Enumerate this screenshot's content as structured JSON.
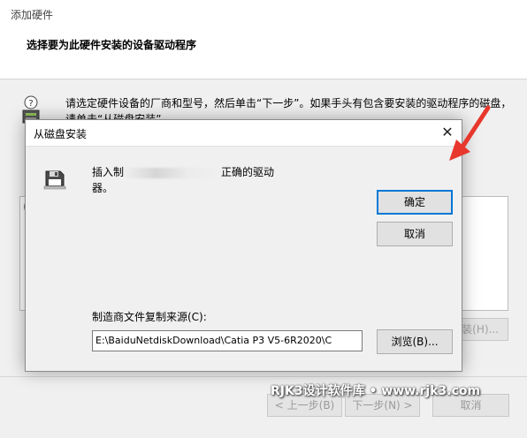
{
  "wizard": {
    "title": "添加硬件",
    "heading": "选择要为此硬件安装的设备驱动程序",
    "instruction_line1": "请选定硬件设备的厂商和型号，然后单击“下一步”。如果手头有包含要安装的驱动程序的磁盘，",
    "instruction_line2": "请单击“从磁盘安装”。",
    "list_fragment": "(",
    "disk_button": "装(H)...",
    "back_button": "< 上一步(B)",
    "next_button": "下一步(N) >",
    "cancel_button": "取消"
  },
  "dialog": {
    "title": "从磁盘安装",
    "close_glyph": "✕",
    "message_start": "插入制",
    "message_end": "正确的驱动",
    "message_line2": "器。",
    "ok_button": "确定",
    "cancel_button": "取消",
    "source_label": "制造商文件复制来源(C):",
    "source_path": "E:\\BaiduNetdiskDownload\\Catia P3 V5-6R2020\\C",
    "browse_button": "浏览(B)..."
  },
  "watermark": "RJK3设计软件库 • www.rjk3.com",
  "colors": {
    "accent": "#0078d7",
    "arrow": "#e8372c"
  },
  "icons": {
    "info": "hardware-info-icon",
    "floppy": "floppy-disk-icon",
    "close": "close-icon"
  }
}
